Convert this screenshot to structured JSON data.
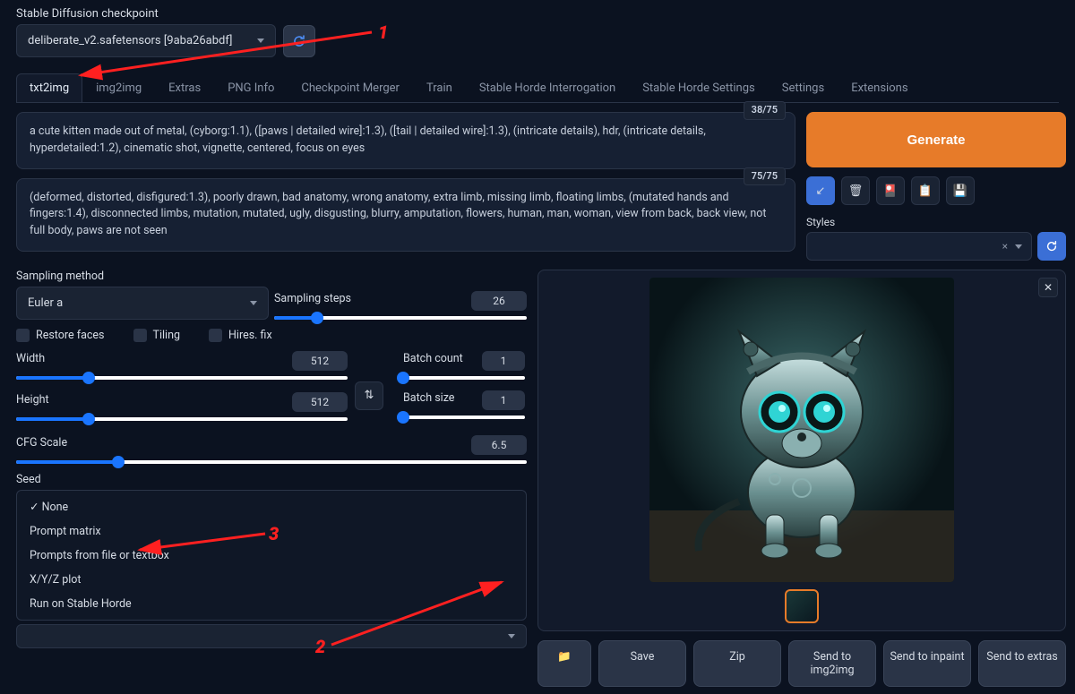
{
  "checkpoint": {
    "label": "Stable Diffusion checkpoint",
    "selected": "deliberate_v2.safetensors [9aba26abdf]"
  },
  "tabs": [
    {
      "id": "txt2img",
      "label": "txt2img",
      "active": true
    },
    {
      "id": "img2img",
      "label": "img2img",
      "active": false
    },
    {
      "id": "extras",
      "label": "Extras",
      "active": false
    },
    {
      "id": "pnginfo",
      "label": "PNG Info",
      "active": false
    },
    {
      "id": "merger",
      "label": "Checkpoint Merger",
      "active": false
    },
    {
      "id": "train",
      "label": "Train",
      "active": false
    },
    {
      "id": "horde-int",
      "label": "Stable Horde Interrogation",
      "active": false
    },
    {
      "id": "horde-set",
      "label": "Stable Horde Settings",
      "active": false
    },
    {
      "id": "settings",
      "label": "Settings",
      "active": false
    },
    {
      "id": "extensions",
      "label": "Extensions",
      "active": false
    }
  ],
  "prompt": {
    "text": "a cute kitten made out of metal, (cyborg:1.1), ([paws | detailed wire]:1.3), ([tail | detailed wire]:1.3), (intricate details), hdr, (intricate details, hyperdetailed:1.2), cinematic shot, vignette, centered, focus on eyes",
    "tokens": "38/75"
  },
  "neg_prompt": {
    "text": "(deformed, distorted, disfigured:1.3), poorly drawn, bad anatomy, wrong anatomy, extra limb, missing limb, floating limbs, (mutated hands and fingers:1.4), disconnected limbs, mutation, mutated, ugly, disgusting, blurry, amputation, flowers, human, man, woman, view from  back, back view, not full body, paws are not seen",
    "tokens": "75/75"
  },
  "generate_label": "Generate",
  "styles": {
    "label": "Styles",
    "clear": "×"
  },
  "sampling": {
    "method_label": "Sampling method",
    "method_value": "Euler a",
    "steps_label": "Sampling steps",
    "steps_value": "26"
  },
  "checkboxes": {
    "restore": "Restore faces",
    "tiling": "Tiling",
    "hires": "Hires. fix"
  },
  "width": {
    "label": "Width",
    "value": "512"
  },
  "height": {
    "label": "Height",
    "value": "512"
  },
  "batch_count": {
    "label": "Batch count",
    "value": "1"
  },
  "batch_size": {
    "label": "Batch size",
    "value": "1"
  },
  "cfg": {
    "label": "CFG Scale",
    "value": "6.5"
  },
  "seed": {
    "label": "Seed"
  },
  "script_menu": [
    "✓ None",
    "Prompt matrix",
    "Prompts from file or textbox",
    "X/Y/Z plot",
    "Run on Stable Horde"
  ],
  "actions": {
    "folder": "📁",
    "save": "Save",
    "zip": "Zip",
    "send_img2img": "Send to img2img",
    "send_inpaint": "Send to inpaint",
    "send_extras": "Send to extras"
  },
  "annotations": {
    "1": "1",
    "2": "2",
    "3": "3"
  }
}
